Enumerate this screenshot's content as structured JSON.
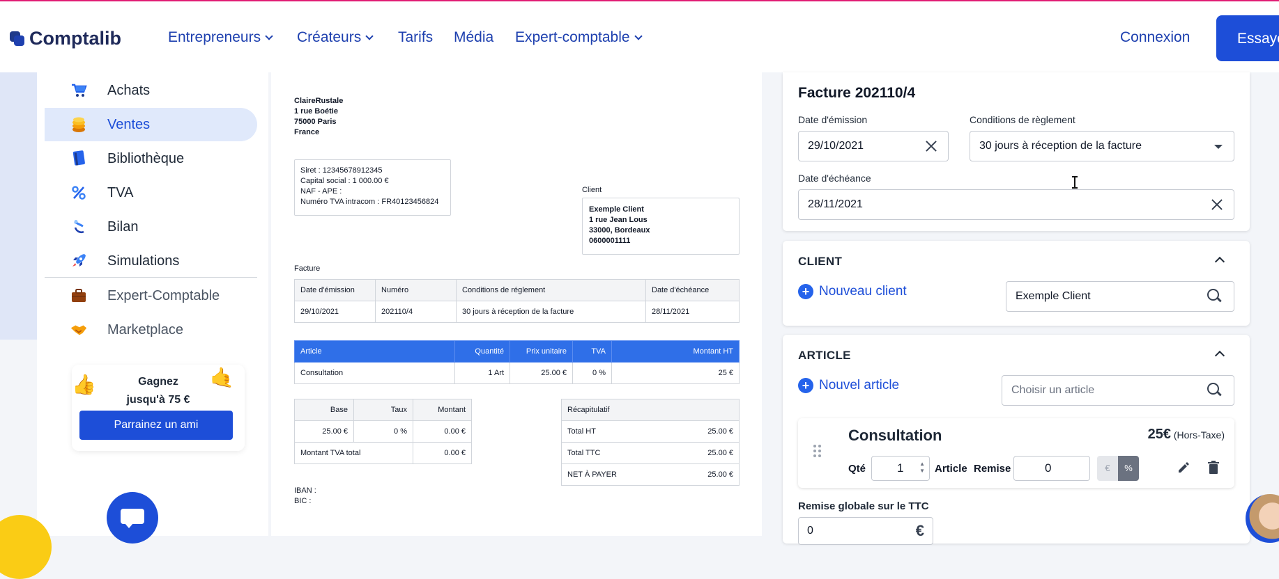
{
  "nav": {
    "brand": "Comptalib",
    "items": [
      {
        "label": "Entrepreneurs",
        "dropdown": true
      },
      {
        "label": "Créateurs",
        "dropdown": true
      },
      {
        "label": "Tarifs",
        "dropdown": false
      },
      {
        "label": "Média",
        "dropdown": false
      },
      {
        "label": "Expert-comptable",
        "dropdown": true
      }
    ],
    "login": "Connexion",
    "cta": "Essaye"
  },
  "sidebar": {
    "items": [
      {
        "label": "Achats",
        "icon": "cart-icon"
      },
      {
        "label": "Ventes",
        "icon": "coins-icon",
        "active": true
      },
      {
        "label": "Bibliothèque",
        "icon": "book-icon"
      },
      {
        "label": "TVA",
        "icon": "percent-icon"
      },
      {
        "label": "Bilan",
        "icon": "scale-icon"
      },
      {
        "label": "Simulations",
        "icon": "rocket-icon"
      },
      {
        "label": "Expert-Comptable",
        "icon": "briefcase-icon"
      },
      {
        "label": "Marketplace",
        "icon": "handshake-icon"
      }
    ],
    "promo": {
      "line1": "Gagnez",
      "line2": "jusqu'à 75 €",
      "button": "Parrainez un ami"
    }
  },
  "invoice": {
    "sender": {
      "name": "ClaireRustale",
      "street": "1 rue Boétie",
      "city": "75000 Paris",
      "country": "France"
    },
    "legal": {
      "siret": "Siret : 12345678912345",
      "capital": "Capital social : 1 000.00 €",
      "naf": "NAF - APE :",
      "tva": "Numéro TVA intracom : FR40123456824"
    },
    "client_heading": "Client",
    "client": {
      "name": "Exemple Client",
      "street": "1 rue Jean Lous",
      "city": "33000, Bordeaux",
      "phone": "0600001111"
    },
    "facture_heading": "Facture",
    "meta_headers": [
      "Date d'émission",
      "Numéro",
      "Conditions de réglement",
      "Date d'échéance"
    ],
    "meta_values": [
      "29/10/2021",
      "202110/4",
      "30 jours à réception de la facture",
      "28/11/2021"
    ],
    "line_headers": [
      "Article",
      "Quantité",
      "Prix unitaire",
      "TVA",
      "Montant HT"
    ],
    "lines": [
      [
        "Consultation",
        "1 Art",
        "25.00 €",
        "0 %",
        "25 €"
      ]
    ],
    "tax_headers": [
      "Base",
      "Taux",
      "Montant"
    ],
    "tax_row": [
      "25.00 €",
      "0 %",
      "0.00 €"
    ],
    "tax_total_label": "Montant TVA total",
    "tax_total_value": "0.00 €",
    "recap_title": "Récapitulatif",
    "recap": [
      {
        "label": "Total HT",
        "value": "25.00 €"
      },
      {
        "label": "Total TTC",
        "value": "25.00 €"
      },
      {
        "label": "NET À PAYER",
        "value": "25.00 €"
      }
    ],
    "iban": "IBAN :",
    "bic": "BIC :"
  },
  "form": {
    "title": "Facture 202110/4",
    "emission_label": "Date d'émission",
    "emission_value": "29/10/2021",
    "conditions_label": "Conditions de règlement",
    "conditions_value": "30 jours à réception de la facture",
    "echeance_label": "Date d'échéance",
    "echeance_value": "28/11/2021",
    "client_section": "CLIENT",
    "new_client": "Nouveau client",
    "client_value": "Exemple Client",
    "article_section": "ARTICLE",
    "new_article": "Nouvel article",
    "article_placeholder": "Choisir un article",
    "item": {
      "name": "Consultation",
      "price": "25€",
      "price_note": "(Hors-Taxe)",
      "qty_label": "Qté",
      "qty_value": "1",
      "unit_label": "Article",
      "discount_label": "Remise",
      "discount_value": "0",
      "euro_toggle": "€",
      "percent_toggle": "%"
    },
    "global_discount_label": "Remise globale sur le TTC",
    "global_discount_value": "0",
    "global_discount_unit": "€"
  },
  "colors": {
    "primary": "#1d4ed8",
    "nav_text": "#1e40af",
    "active_bg": "#e0e9fb",
    "table_header": "#2f6fe8",
    "top_line": "#e11d74"
  }
}
